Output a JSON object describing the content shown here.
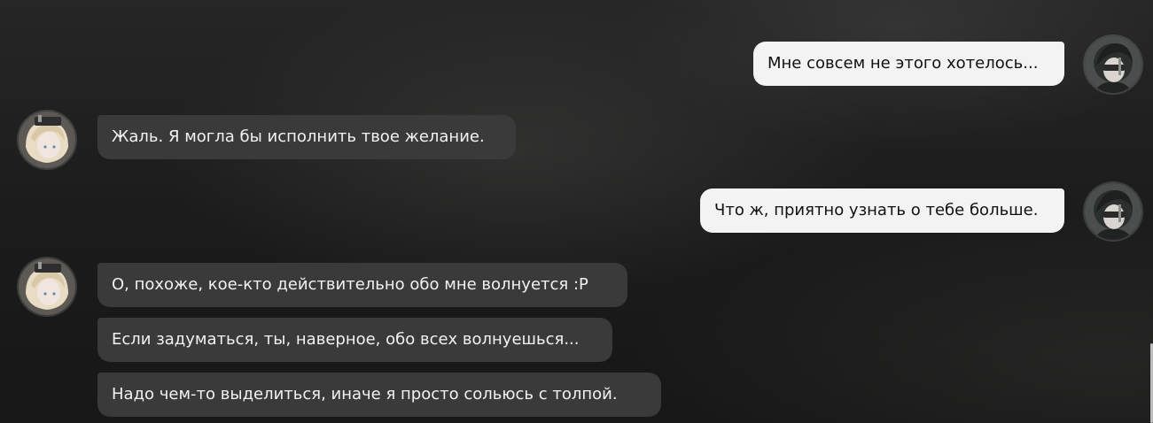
{
  "colors": {
    "background": "#1d1d1d",
    "outgoing_bubble": "#f3f3f3",
    "outgoing_text": "#111111",
    "incoming_bubble": "#3a3a3a",
    "incoming_text": "#f2f2f2"
  },
  "participants": {
    "user": {
      "avatar_icon": "dark-haired-masked-character-avatar"
    },
    "companion": {
      "avatar_icon": "blonde-character-avatar"
    }
  },
  "messages": [
    {
      "sender": "user",
      "text": "Мне совсем не этого хотелось..."
    },
    {
      "sender": "companion",
      "text": "Жаль. Я могла бы исполнить твое желание."
    },
    {
      "sender": "user",
      "text": "Что ж, приятно узнать о тебе больше."
    },
    {
      "sender": "companion",
      "text": "О, похоже, кое-кто действительно обо мне волнуется :P"
    },
    {
      "sender": "companion",
      "text": "Если задуматься, ты, наверное, обо всех волнуешься..."
    },
    {
      "sender": "companion",
      "text": "Надо чем-то выделиться, иначе я просто сольюсь с толпой."
    }
  ]
}
